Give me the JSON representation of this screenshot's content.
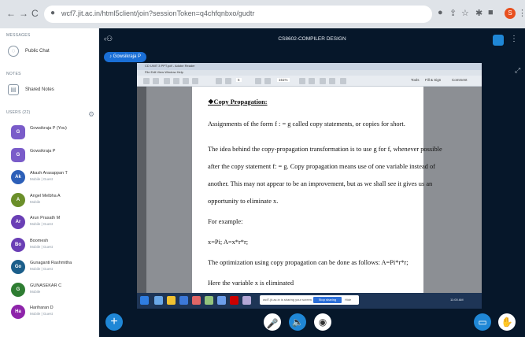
{
  "browser": {
    "back": "←",
    "forward": "→",
    "reload": "C",
    "url": "wcf7.jit.ac.in/html5client/join?sessionToken=q4chfqnbxo/gudtr",
    "profile_letter": "S"
  },
  "left": {
    "messages_heading": "MESSAGES",
    "public_chat": "Public Chat",
    "notes_heading": "NOTES",
    "shared_notes": "Shared Notes",
    "users_heading": "USERS (22)",
    "users": [
      {
        "initials": "G",
        "name": "Gowsikraja P (You)",
        "role": "",
        "color": "#7a5cc9"
      },
      {
        "initials": "G",
        "name": "Gowsikraja P",
        "role": "",
        "color": "#7a5cc9"
      },
      {
        "initials": "Ak",
        "name": "Akash Arasappan T",
        "role": "Mobile | Guest",
        "color": "#2c5fb8"
      },
      {
        "initials": "A",
        "name": "Angel Melbha A",
        "role": "Mobile",
        "color": "#6b8f2a"
      },
      {
        "initials": "Ar",
        "name": "Arun Prasath M",
        "role": "Mobile | Guest",
        "color": "#6a3fb5"
      },
      {
        "initials": "Bo",
        "name": "Boomesh",
        "role": "Mobile | Guest",
        "color": "#6a3fb5"
      },
      {
        "initials": "Go",
        "name": "Gunaganti Rashmitha",
        "role": "Mobile | Guest",
        "color": "#1b5e8a"
      },
      {
        "initials": "G",
        "name": "GUNASEKAR C",
        "role": "Mobile",
        "color": "#2e7d32"
      },
      {
        "initials": "Ha",
        "name": "Hariharan D",
        "role": "Mobile | Guest",
        "color": "#8e24aa"
      }
    ]
  },
  "main": {
    "title": "CS8602-COMPILER DESIGN",
    "presenter": "Gowsikraja P",
    "pdf_title": "CD UNIT 3 PPT.pdf - Adobe Reader",
    "pdf_menu": "File  Edit  View  Window  Help",
    "pdf_tools": [
      "Tools",
      "Fill & Sign",
      "Comment"
    ],
    "page_num": "5",
    "zoom": "151%",
    "doc": {
      "heading": "Copy Propagation:",
      "lines": [
        "Assignments of the form f : = g called copy statements, or copies for short.",
        "The idea behind the copy-propagation transformation is to use g for f, whenever possible",
        "after the copy statement f: = g. Copy propagation means use of one variable instead of",
        "another. This may not appear to be an improvement, but as we shall see it gives us an",
        "opportunity to eliminate x.",
        "For example:",
        "x=Pi; A=x*r*r;",
        "The optimization using copy propagation can be done as follows: A=Pi*r*r;",
        "Here the variable x is eliminated"
      ]
    },
    "share_msg": "wcf7.jit.ac.in is sharing your screen.",
    "stop_sharing": "Stop sharing",
    "hide": "Hide",
    "clock": "11:00 AM"
  }
}
